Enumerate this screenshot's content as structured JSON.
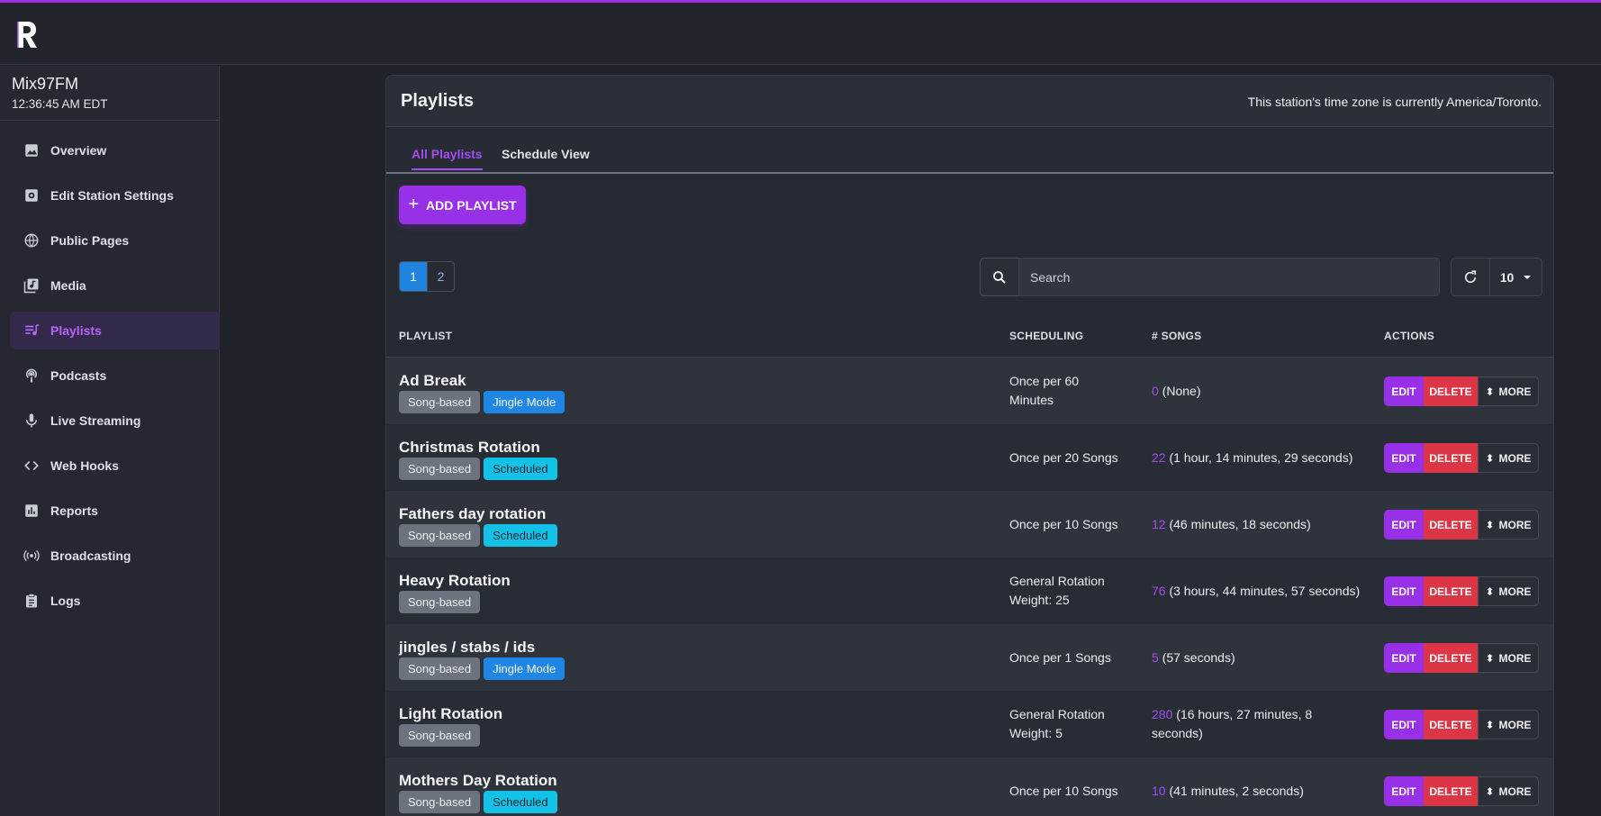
{
  "colors": {
    "accent": "#9730e6",
    "danger": "#dc3545",
    "info": "#1f86e4",
    "cyan": "#14c2e8"
  },
  "station": {
    "name": "Mix97FM",
    "time": "12:36:45 AM EDT"
  },
  "sidebar": {
    "items": [
      {
        "label": "Overview",
        "icon": "image-icon"
      },
      {
        "label": "Edit Station Settings",
        "icon": "settings-icon"
      },
      {
        "label": "Public Pages",
        "icon": "globe-icon"
      },
      {
        "label": "Media",
        "icon": "library-music-icon"
      },
      {
        "label": "Playlists",
        "icon": "playlist-icon",
        "active": true
      },
      {
        "label": "Podcasts",
        "icon": "podcast-icon"
      },
      {
        "label": "Live Streaming",
        "icon": "mic-icon"
      },
      {
        "label": "Web Hooks",
        "icon": "code-icon"
      },
      {
        "label": "Reports",
        "icon": "bar-chart-icon"
      },
      {
        "label": "Broadcasting",
        "icon": "broadcast-icon"
      },
      {
        "label": "Logs",
        "icon": "clipboard-icon"
      }
    ]
  },
  "card": {
    "title": "Playlists",
    "timezone_note": "This station's time zone is currently America/Toronto.",
    "tabs": [
      {
        "label": "All Playlists",
        "active": true
      },
      {
        "label": "Schedule View"
      }
    ],
    "add_button": "ADD PLAYLIST",
    "pagination": [
      "1",
      "2"
    ],
    "search_placeholder": "Search",
    "per_page": "10"
  },
  "table": {
    "headers": {
      "playlist": "PLAYLIST",
      "scheduling": "SCHEDULING",
      "songs": "# SONGS",
      "actions": "ACTIONS"
    },
    "action_labels": {
      "edit": "EDIT",
      "delete": "DELETE",
      "more": "MORE"
    },
    "rows": [
      {
        "name": "Ad Break",
        "badges": [
          {
            "text": "Song-based",
            "kind": "gray"
          },
          {
            "text": "Jingle Mode",
            "kind": "blue"
          }
        ],
        "scheduling": [
          "Once per 60",
          "Minutes"
        ],
        "count": "0",
        "duration": [
          "(None)"
        ]
      },
      {
        "name": "Christmas Rotation",
        "badges": [
          {
            "text": "Song-based",
            "kind": "gray"
          },
          {
            "text": "Scheduled",
            "kind": "cyan"
          }
        ],
        "scheduling": [
          "Once per 20 Songs"
        ],
        "count": "22",
        "duration": [
          "(1 hour, 14 minutes, 29 seconds)"
        ]
      },
      {
        "name": "Fathers day rotation",
        "badges": [
          {
            "text": "Song-based",
            "kind": "gray"
          },
          {
            "text": "Scheduled",
            "kind": "cyan"
          }
        ],
        "scheduling": [
          "Once per 10 Songs"
        ],
        "count": "12",
        "duration": [
          "(46 minutes, 18 seconds)"
        ]
      },
      {
        "name": "Heavy Rotation",
        "badges": [
          {
            "text": "Song-based",
            "kind": "gray"
          }
        ],
        "scheduling": [
          "General Rotation",
          "Weight: 25"
        ],
        "count": "76",
        "duration": [
          "(3 hours, 44 minutes, 57 seconds)"
        ]
      },
      {
        "name": "jingles / stabs / ids",
        "badges": [
          {
            "text": "Song-based",
            "kind": "gray"
          },
          {
            "text": "Jingle Mode",
            "kind": "blue"
          }
        ],
        "scheduling": [
          "Once per 1 Songs"
        ],
        "count": "5",
        "duration": [
          "(57 seconds)"
        ]
      },
      {
        "name": "Light Rotation",
        "badges": [
          {
            "text": "Song-based",
            "kind": "gray"
          }
        ],
        "scheduling": [
          "General Rotation",
          "Weight: 5"
        ],
        "count": "280",
        "duration": [
          "(16 hours, 27 minutes, 8",
          "seconds)"
        ]
      },
      {
        "name": "Mothers Day Rotation",
        "badges": [
          {
            "text": "Song-based",
            "kind": "gray"
          },
          {
            "text": "Scheduled",
            "kind": "cyan"
          }
        ],
        "scheduling": [
          "Once per 10 Songs"
        ],
        "count": "10",
        "duration": [
          "(41 minutes, 2 seconds)"
        ]
      }
    ]
  }
}
